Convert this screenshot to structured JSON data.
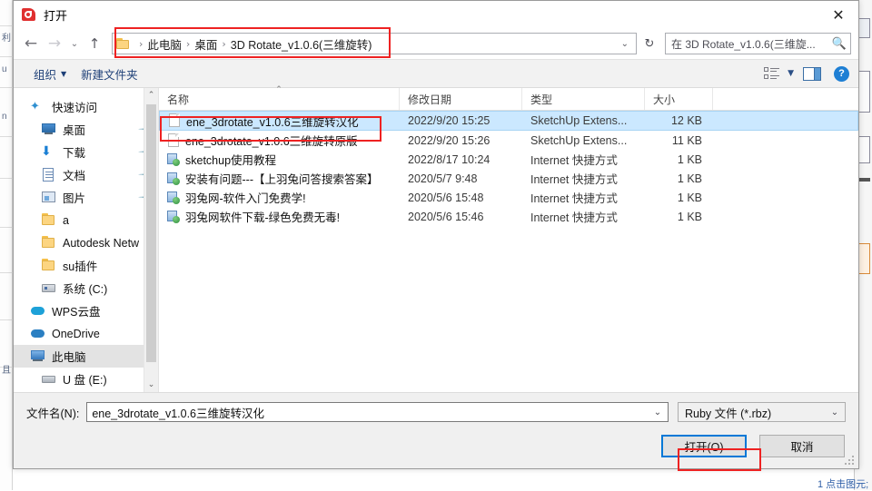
{
  "window": {
    "title": "打开",
    "app_icon": "sketchup-icon",
    "close_label": "✕"
  },
  "nav": {
    "back_icon": "←",
    "forward_icon": "→",
    "history_icon": "⌄",
    "up_icon": "↑",
    "refresh_icon": "↻",
    "breadcrumb_dropdown_icon": "⌄"
  },
  "breadcrumb": {
    "separator": "›",
    "items": [
      {
        "label": "此电脑"
      },
      {
        "label": "桌面"
      },
      {
        "label": "3D Rotate_v1.0.6(三维旋转)"
      }
    ]
  },
  "search": {
    "value": "在 3D Rotate_v1.0.6(三维旋...",
    "icon": "search-icon"
  },
  "command_bar": {
    "organize": "组织",
    "organize_caret": "▼",
    "new_folder": "新建文件夹",
    "view_caret": "▼",
    "help": "?"
  },
  "sidebar": {
    "scroll_up_icon": "⌃",
    "scroll_down_icon": "⌄",
    "items": [
      {
        "label": "快速访问",
        "icon": "star-icon",
        "indent": false,
        "pinned": false,
        "selected": false
      },
      {
        "label": "桌面",
        "icon": "desktop-icon",
        "indent": true,
        "pinned": true,
        "selected": false
      },
      {
        "label": "下载",
        "icon": "download-icon",
        "indent": true,
        "pinned": true,
        "selected": false
      },
      {
        "label": "文档",
        "icon": "documents-icon",
        "indent": true,
        "pinned": true,
        "selected": false
      },
      {
        "label": "图片",
        "icon": "pictures-icon",
        "indent": true,
        "pinned": true,
        "selected": false
      },
      {
        "label": "a",
        "icon": "folder-icon",
        "indent": true,
        "pinned": false,
        "selected": false
      },
      {
        "label": "Autodesk Netw",
        "icon": "folder-icon",
        "indent": true,
        "pinned": false,
        "selected": false
      },
      {
        "label": "su插件",
        "icon": "folder-icon",
        "indent": true,
        "pinned": false,
        "selected": false
      },
      {
        "label": "系统 (C:)",
        "icon": "drive-icon",
        "indent": true,
        "pinned": false,
        "selected": false
      },
      {
        "label": "WPS云盘",
        "icon": "cloud-wps-icon",
        "indent": false,
        "pinned": false,
        "selected": false
      },
      {
        "label": "OneDrive",
        "icon": "cloud-onedrive-icon",
        "indent": false,
        "pinned": false,
        "selected": false
      },
      {
        "label": "此电脑",
        "icon": "this-pc-icon",
        "indent": false,
        "pinned": false,
        "selected": true
      },
      {
        "label": "U 盘 (E:)",
        "icon": "usb-drive-icon",
        "indent": true,
        "pinned": false,
        "selected": false
      }
    ]
  },
  "file_list": {
    "columns": [
      {
        "label": "名称",
        "sorted": true,
        "sort_icon": "⌃"
      },
      {
        "label": "修改日期",
        "sorted": false,
        "sort_icon": ""
      },
      {
        "label": "类型",
        "sorted": false,
        "sort_icon": ""
      },
      {
        "label": "大小",
        "sorted": false,
        "sort_icon": ""
      }
    ],
    "rows": [
      {
        "name": "ene_3drotate_v1.0.6三维旋转汉化",
        "date": "2022/9/20 15:25",
        "type": "SketchUp Extens...",
        "size": "12 KB",
        "icon": "rbz-file-icon",
        "selected": true
      },
      {
        "name": "ene_3drotate_v1.0.6三维旋转原版",
        "date": "2022/9/20 15:26",
        "type": "SketchUp Extens...",
        "size": "11 KB",
        "icon": "rbz-file-icon",
        "selected": false
      },
      {
        "name": "sketchup使用教程",
        "date": "2022/8/17 10:24",
        "type": "Internet 快捷方式",
        "size": "1 KB",
        "icon": "url-shortcut-icon",
        "selected": false
      },
      {
        "name": "安装有问题---【上羽兔问答搜索答案】",
        "date": "2020/5/7 9:48",
        "type": "Internet 快捷方式",
        "size": "1 KB",
        "icon": "url-shortcut-icon",
        "selected": false
      },
      {
        "name": "羽兔网-软件入门免费学!",
        "date": "2020/5/6 15:48",
        "type": "Internet 快捷方式",
        "size": "1 KB",
        "icon": "url-shortcut-icon",
        "selected": false
      },
      {
        "name": "羽兔网软件下载-绿色免费无毒!",
        "date": "2020/5/6 15:46",
        "type": "Internet 快捷方式",
        "size": "1 KB",
        "icon": "url-shortcut-icon",
        "selected": false
      }
    ]
  },
  "footer": {
    "filename_label": "文件名(N):",
    "filename_value": "ene_3drotate_v1.0.6三维旋转汉化",
    "filename_caret": "⌄",
    "filetype_value": "Ruby 文件 (*.rbz)",
    "filetype_caret": "⌄",
    "open_button": "打开(O)",
    "cancel_button": "取消"
  },
  "background": {
    "status_text": "1 点击图元;",
    "left_glyphs": [
      "利",
      "u",
      "n",
      "且"
    ]
  },
  "annotations": {
    "color": "#ee2222",
    "targets": [
      "breadcrumb-bar",
      "selected-file-row",
      "open-button"
    ]
  }
}
